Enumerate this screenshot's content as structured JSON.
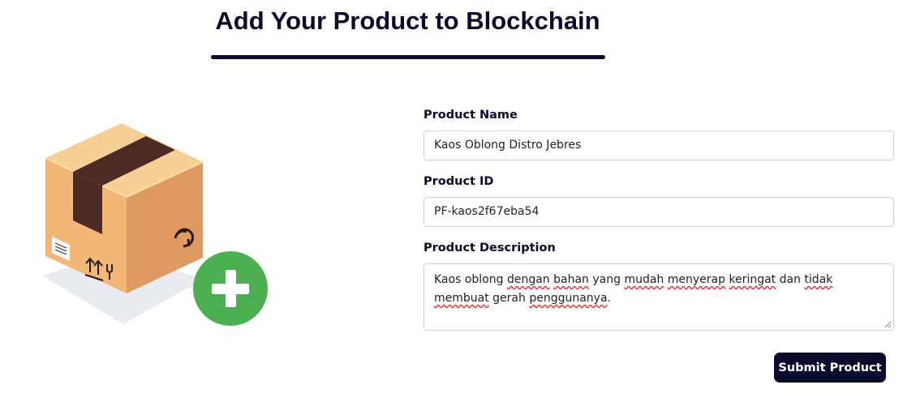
{
  "page": {
    "title": "Add Your Product to Blockchain"
  },
  "illustration": {
    "icon": "package-add-icon",
    "box_colors": {
      "top": "#f5cf94",
      "left": "#f2b777",
      "right": "#df9a62",
      "tape": "#4d2a24"
    },
    "add_badge_color": "#4caf50"
  },
  "form": {
    "product_name": {
      "label": "Product Name",
      "value": "Kaos Oblong Distro Jebres"
    },
    "product_id": {
      "label": "Product ID",
      "value": "PF-kaos2f67eba54"
    },
    "product_description": {
      "label": "Product Description",
      "value": "Kaos oblong dengan bahan yang mudah menyerap keringat dan tidak membuat gerah penggunanya.",
      "segments": [
        {
          "text": "Kaos oblong ",
          "flag": false
        },
        {
          "text": "dengan",
          "flag": true
        },
        {
          "text": " ",
          "flag": false
        },
        {
          "text": "bahan",
          "flag": true
        },
        {
          "text": " yang ",
          "flag": false
        },
        {
          "text": "mudah",
          "flag": true
        },
        {
          "text": " ",
          "flag": false
        },
        {
          "text": "menyerap",
          "flag": true
        },
        {
          "text": " ",
          "flag": false
        },
        {
          "text": "keringat",
          "flag": true
        },
        {
          "text": " dan ",
          "flag": false
        },
        {
          "text": "tidak",
          "flag": true
        },
        {
          "text": " ",
          "flag": false
        },
        {
          "text": "membuat",
          "flag": true
        },
        {
          "text": " gerah ",
          "flag": false
        },
        {
          "text": "penggunanya",
          "flag": true
        },
        {
          "text": ".",
          "flag": false
        }
      ]
    },
    "submit_label": "Submit Product"
  },
  "colors": {
    "primary": "#0b0b2e",
    "input_border": "#cfd4da"
  }
}
